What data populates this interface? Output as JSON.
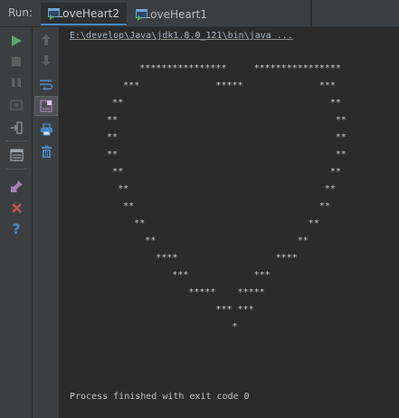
{
  "run_panel": {
    "label": "Run:",
    "tabs": [
      {
        "label": "LoveHeart2",
        "icon": "run-config-icon",
        "selected": true
      },
      {
        "label": "LoveHeart1",
        "icon": "run-config-icon",
        "selected": false
      }
    ]
  },
  "toolbar_left": [
    {
      "name": "rerun-icon",
      "glyph": "▶",
      "color": "#59a869"
    },
    {
      "name": "stop-icon",
      "glyph": "■",
      "color": "#6b6b6b"
    },
    {
      "name": "pause-icon",
      "glyph": "❚❚",
      "color": "#6b6b6b"
    },
    {
      "name": "dump-threads-icon",
      "glyph": "▣",
      "color": "#6b6b6b"
    },
    {
      "name": "exit-icon",
      "glyph": "⇥",
      "color": "#8c8c8c"
    },
    {
      "name": "restore-layout-icon",
      "glyph": "☰",
      "color": "#9aa7b0"
    },
    {
      "name": "pin-icon",
      "glyph": "✎",
      "color": "#a67fb5"
    },
    {
      "name": "close-icon",
      "glyph": "✖",
      "color": "#c75450"
    },
    {
      "name": "help-icon",
      "glyph": "?",
      "color": "#4a88c7"
    }
  ],
  "toolbar_right": [
    {
      "name": "up-arrow-icon",
      "glyph": "↑",
      "color": "#6b6b6b"
    },
    {
      "name": "down-arrow-icon",
      "glyph": "↓",
      "color": "#6b6b6b"
    },
    {
      "name": "soft-wrap-icon",
      "glyph": "⇌",
      "color": "#4a88c7"
    },
    {
      "name": "scroll-to-end-icon",
      "glyph": "⤓",
      "color": "#a67fb5"
    },
    {
      "name": "print-icon",
      "glyph": "⎙",
      "color": "#4a88c7"
    },
    {
      "name": "trash-icon",
      "glyph": "🗑",
      "color": "#4a88c7"
    }
  ],
  "console": {
    "command": "E:\\develop\\Java\\jdk1.8.0_121\\bin\\java ...",
    "heart_lines": [
      "        ****************     ****************",
      "     ***              *****              ***",
      "   **                                      **",
      "  **                                        **",
      "  **                                        **",
      "  **                                        **",
      "   **                                      **",
      "    **                                    **",
      "     **                                  **",
      "       **                              **",
      "         **                          **",
      "           ****                  ****",
      "              ***            ***",
      "                 *****    *****",
      "                      *** ***",
      "                         *"
    ],
    "exit_message": "Process finished with exit code 0"
  }
}
